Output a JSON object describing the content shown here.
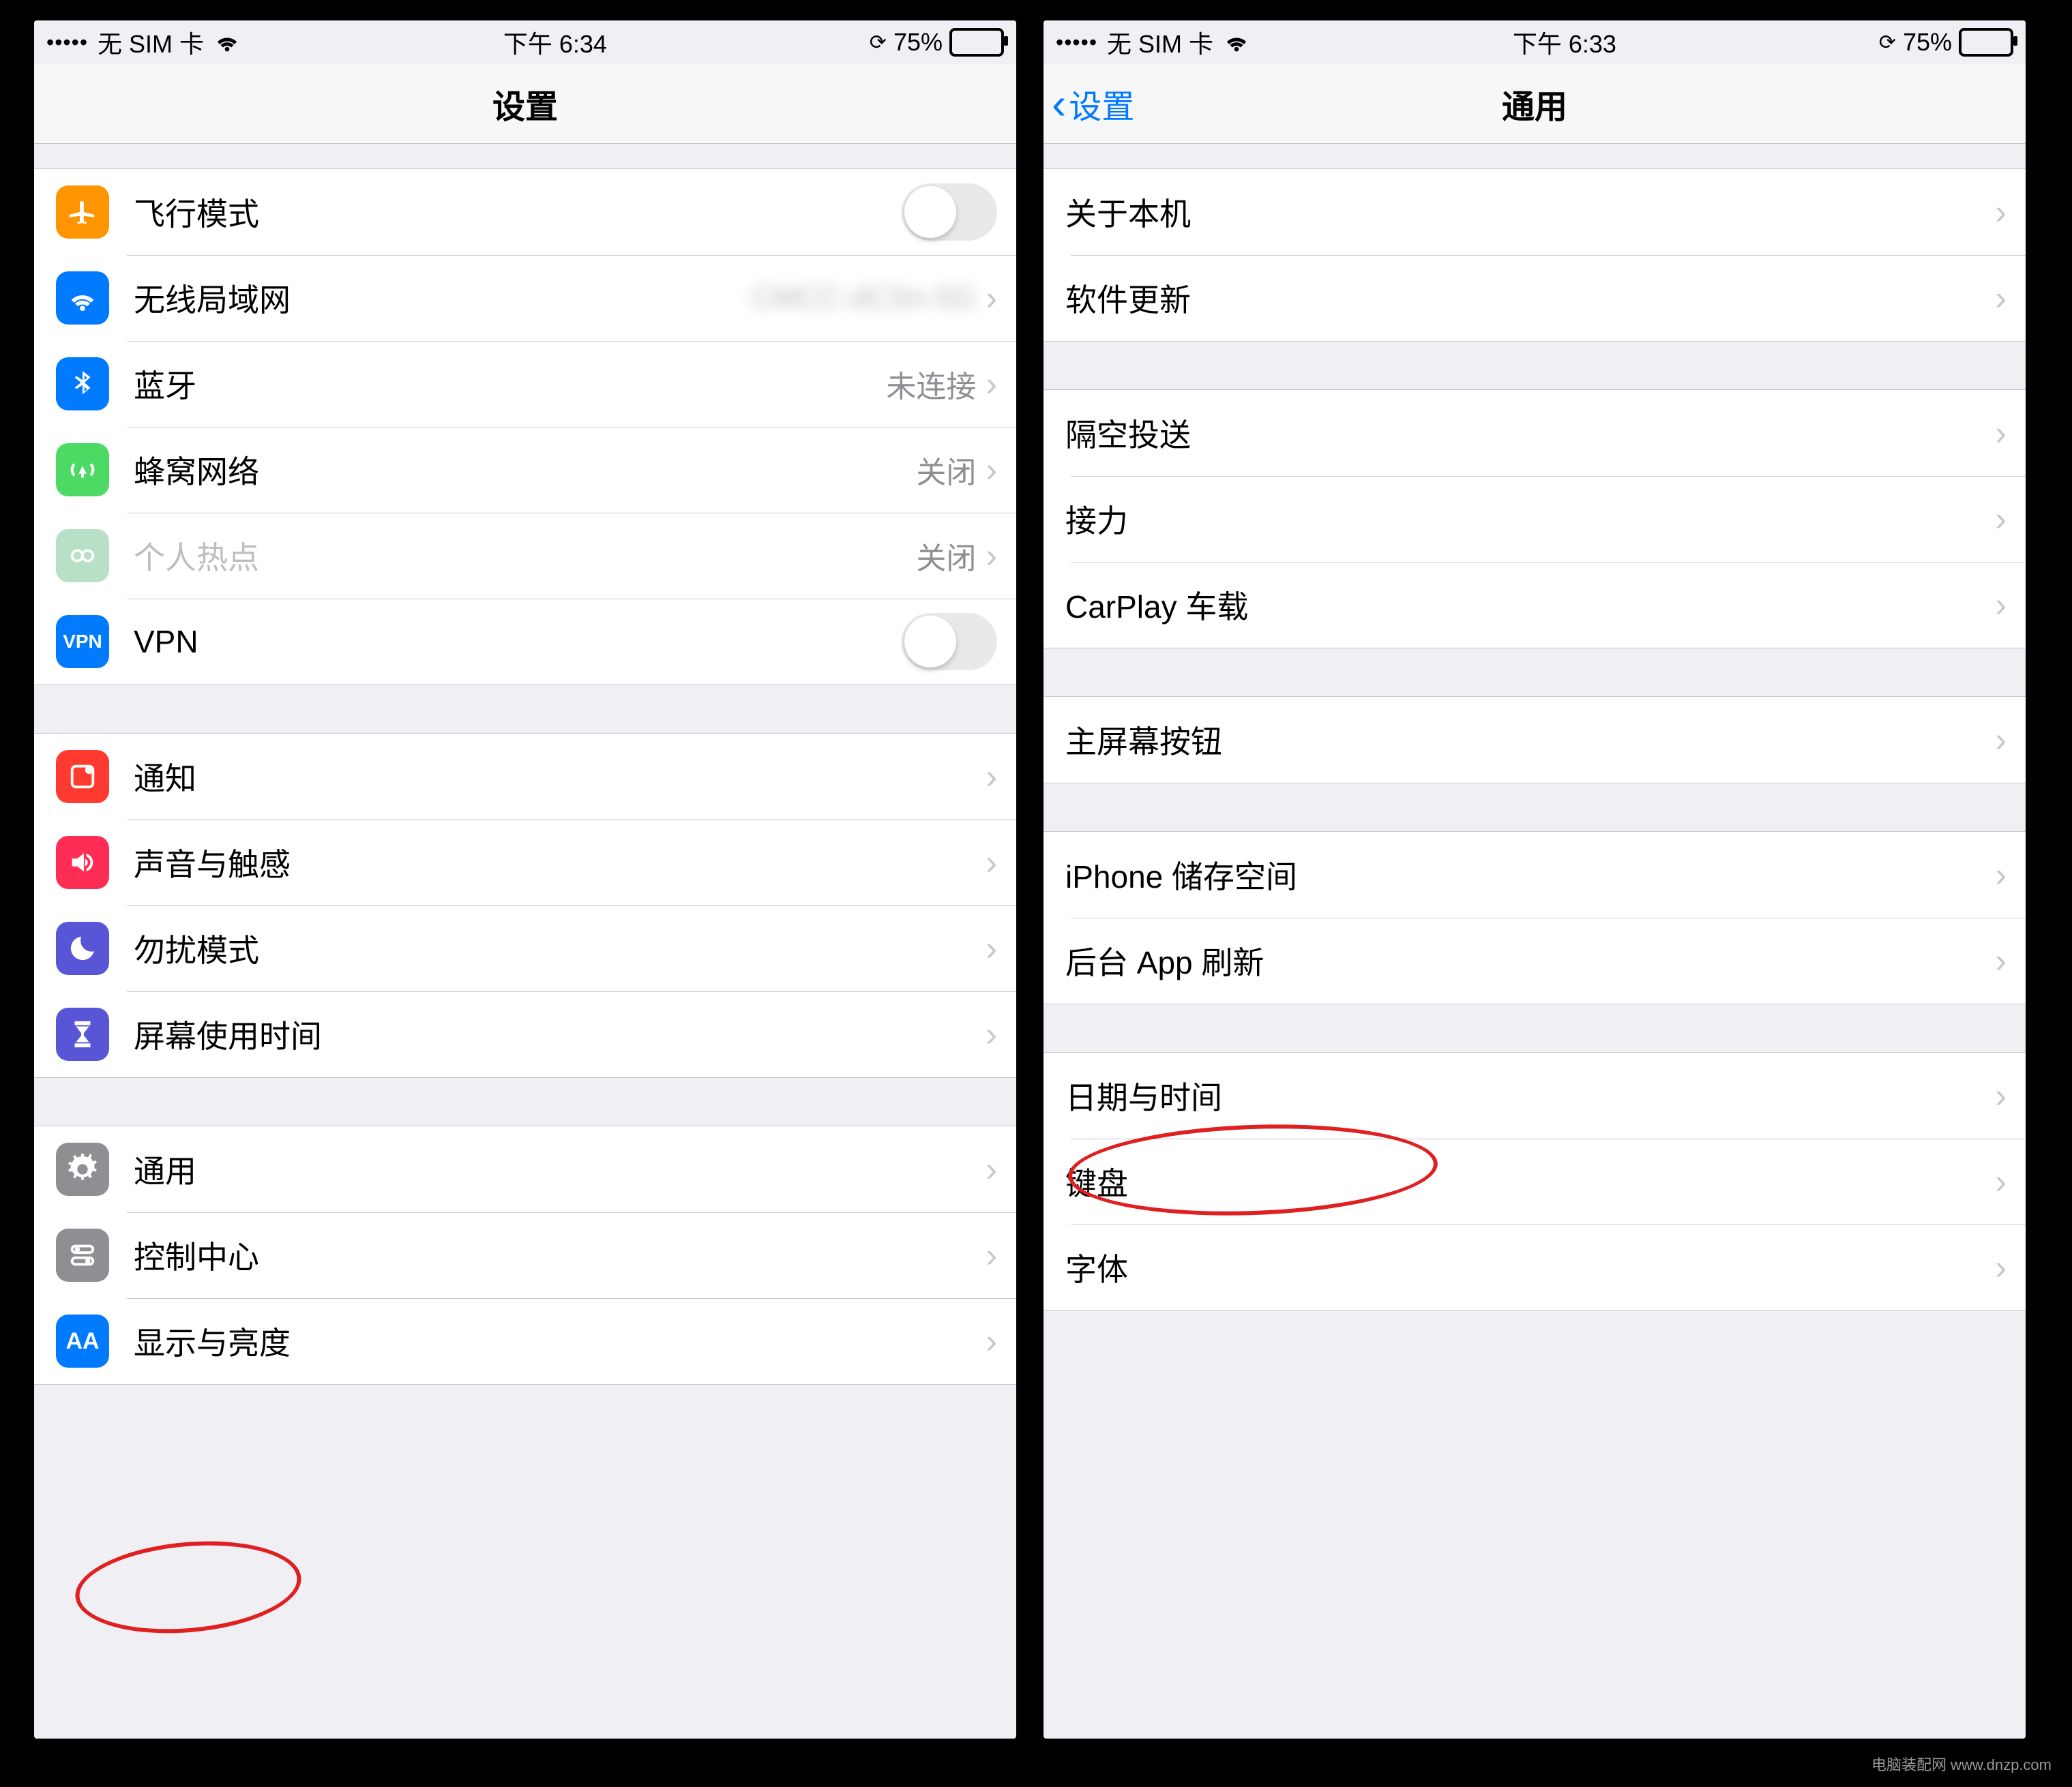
{
  "left": {
    "status": {
      "carrier": "无 SIM 卡",
      "time": "下午 6:34",
      "battery": "75%"
    },
    "nav": {
      "title": "设置"
    },
    "g1": [
      {
        "label": "飞行模式",
        "type": "toggle"
      },
      {
        "label": "无线局域网",
        "value": "CMCC-dCSn-5G",
        "blur": true
      },
      {
        "label": "蓝牙",
        "value": "未连接"
      },
      {
        "label": "蜂窝网络",
        "value": "关闭"
      },
      {
        "label": "个人热点",
        "value": "关闭",
        "dim": true
      },
      {
        "label": "VPN",
        "type": "toggle",
        "vpn": true
      }
    ],
    "g2": [
      {
        "label": "通知"
      },
      {
        "label": "声音与触感"
      },
      {
        "label": "勿扰模式"
      },
      {
        "label": "屏幕使用时间"
      }
    ],
    "g3": [
      {
        "label": "通用"
      },
      {
        "label": "控制中心"
      },
      {
        "label": "显示与亮度"
      }
    ]
  },
  "right": {
    "status": {
      "carrier": "无 SIM 卡",
      "time": "下午 6:33",
      "battery": "75%"
    },
    "nav": {
      "back": "设置",
      "title": "通用"
    },
    "g1": [
      {
        "label": "关于本机"
      },
      {
        "label": "软件更新"
      }
    ],
    "g2": [
      {
        "label": "隔空投送"
      },
      {
        "label": "接力"
      },
      {
        "label": "CarPlay 车载"
      }
    ],
    "g3": [
      {
        "label": "主屏幕按钮"
      }
    ],
    "g4": [
      {
        "label": "iPhone 储存空间"
      },
      {
        "label": "后台 App 刷新"
      }
    ],
    "g5": [
      {
        "label": "日期与时间"
      },
      {
        "label": "键盘"
      },
      {
        "label": "字体"
      }
    ]
  },
  "watermark": "电脑装配网\nwww.dnzp.com"
}
